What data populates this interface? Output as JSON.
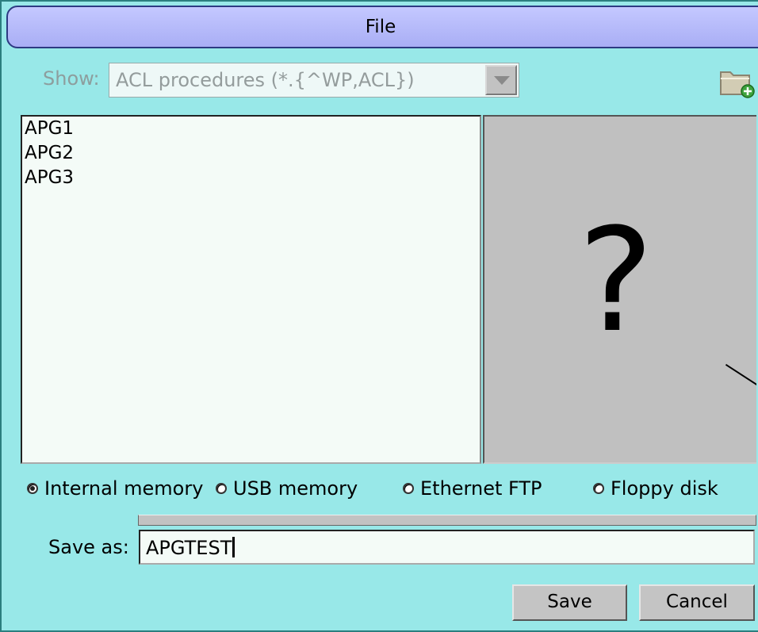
{
  "window": {
    "title": "File"
  },
  "filter": {
    "label": "Show:",
    "value": "ACL procedures (*.{^WP,ACL})"
  },
  "toolbar": {
    "new_folder_icon": "new-folder-icon"
  },
  "files": [
    {
      "name": "APG1"
    },
    {
      "name": "APG2"
    },
    {
      "name": "APG3"
    }
  ],
  "preview": {
    "placeholder": "?"
  },
  "storage": {
    "options": [
      {
        "label": "Internal memory",
        "selected": true
      },
      {
        "label": "USB memory",
        "selected": false
      },
      {
        "label": "Ethernet FTP",
        "selected": false
      },
      {
        "label": "Floppy disk",
        "selected": false
      }
    ]
  },
  "save_as": {
    "label": "Save as:",
    "value": "APGTEST"
  },
  "buttons": {
    "save": "Save",
    "cancel": "Cancel"
  },
  "colors": {
    "background": "#98e8e8",
    "titlebar": "#b4b8f8",
    "button": "#c4c4c4",
    "preview": "#c0c0c0"
  }
}
